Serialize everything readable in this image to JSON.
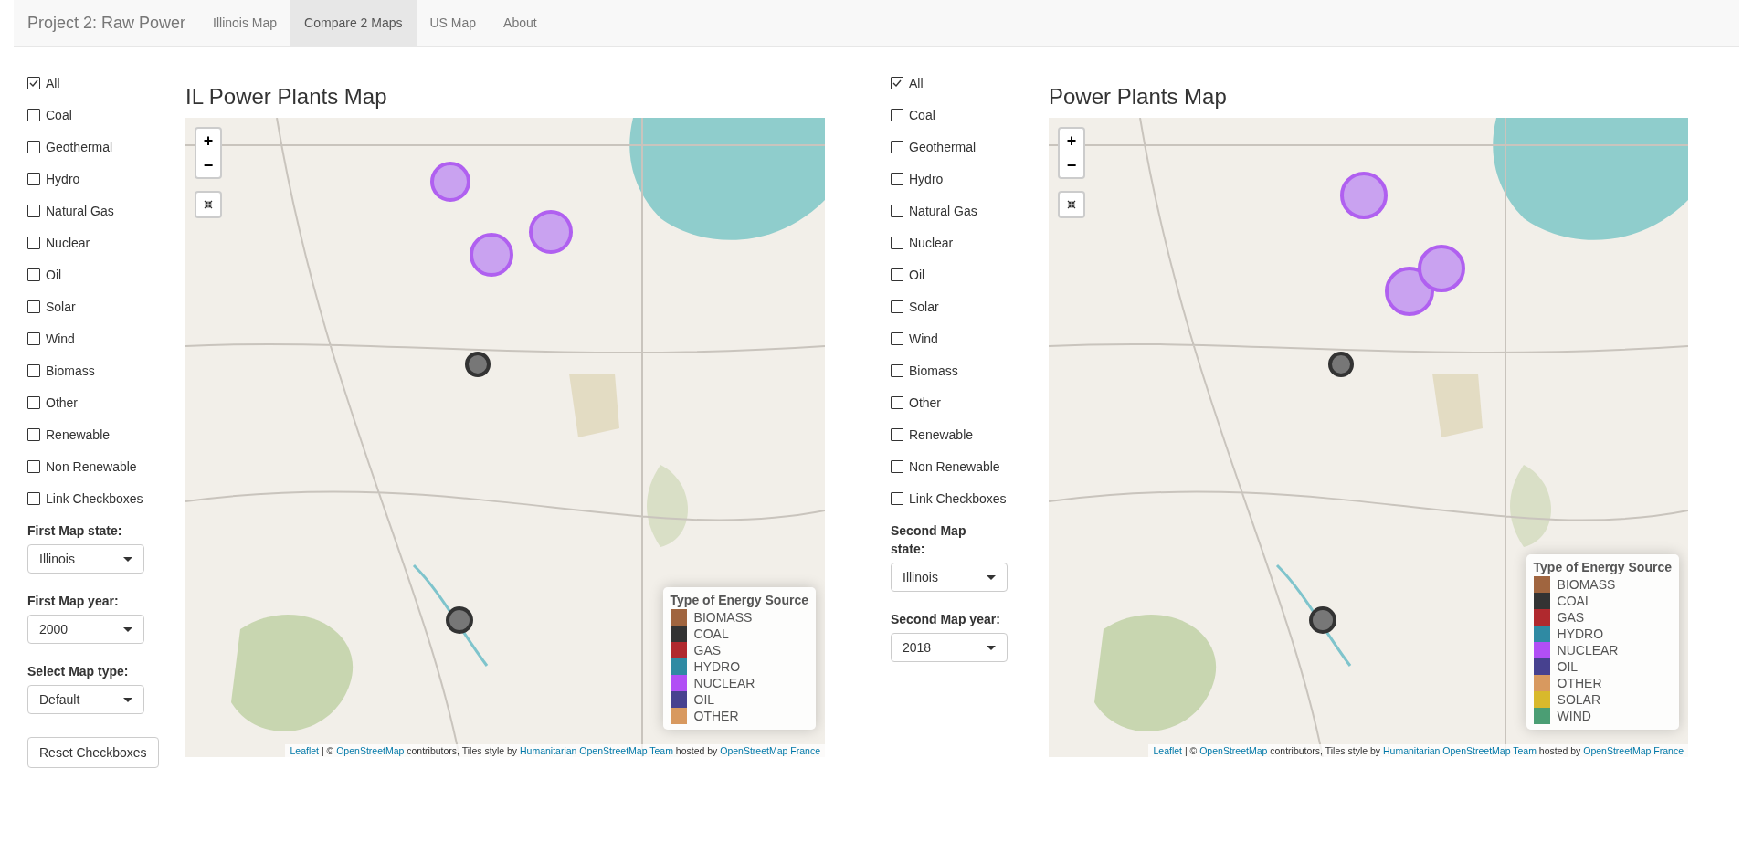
{
  "navbar": {
    "brand": "Project 2: Raw Power",
    "tabs": [
      {
        "label": "Illinois Map",
        "selected": false
      },
      {
        "label": "Compare 2 Maps",
        "selected": true
      },
      {
        "label": "US Map",
        "selected": false
      },
      {
        "label": "About",
        "selected": false
      }
    ]
  },
  "panels": [
    {
      "filters": [
        {
          "label": "All",
          "checked": true
        },
        {
          "label": "Coal",
          "checked": false
        },
        {
          "label": "Geothermal",
          "checked": false
        },
        {
          "label": "Hydro",
          "checked": false
        },
        {
          "label": "Natural Gas",
          "checked": false
        },
        {
          "label": "Nuclear",
          "checked": false
        },
        {
          "label": "Oil",
          "checked": false
        },
        {
          "label": "Solar",
          "checked": false
        },
        {
          "label": "Wind",
          "checked": false
        },
        {
          "label": "Biomass",
          "checked": false
        },
        {
          "label": "Other",
          "checked": false
        },
        {
          "label": "Renewable",
          "checked": false
        },
        {
          "label": "Non Renewable",
          "checked": false
        },
        {
          "label": "Link Checkboxes",
          "checked": false
        }
      ],
      "selects": [
        {
          "label": "First Map state:",
          "value": "Illinois"
        },
        {
          "label": "First Map year:",
          "value": "2000"
        },
        {
          "label": "Select Map type:",
          "value": "Default"
        }
      ],
      "button": "Reset Checkboxes",
      "map": {
        "title": "IL Power Plants Map",
        "zoom_in": "+",
        "zoom_out": "−",
        "legend": {
          "title": "Type of Energy Source",
          "items": [
            {
              "label": "BIOMASS",
              "color": "#a0653f"
            },
            {
              "label": "COAL",
              "color": "#333333"
            },
            {
              "label": "GAS",
              "color": "#b0292e"
            },
            {
              "label": "HYDRO",
              "color": "#2f8aa3"
            },
            {
              "label": "NUCLEAR",
              "color": "#b14ff5"
            },
            {
              "label": "OIL",
              "color": "#47418f"
            },
            {
              "label": "OTHER",
              "color": "#d8995f"
            }
          ]
        },
        "attribution": [
          {
            "text": "Leaflet",
            "link": true
          },
          {
            "text": " | © ",
            "link": false
          },
          {
            "text": "OpenStreetMap",
            "link": true
          },
          {
            "text": " contributors, Tiles style by ",
            "link": false
          },
          {
            "text": "Humanitarian OpenStreetMap Team",
            "link": true
          },
          {
            "text": " hosted by ",
            "link": false
          },
          {
            "text": "OpenStreetMap France",
            "link": true
          }
        ]
      }
    },
    {
      "filters": [
        {
          "label": "All",
          "checked": true
        },
        {
          "label": "Coal",
          "checked": false
        },
        {
          "label": "Geothermal",
          "checked": false
        },
        {
          "label": "Hydro",
          "checked": false
        },
        {
          "label": "Natural Gas",
          "checked": false
        },
        {
          "label": "Nuclear",
          "checked": false
        },
        {
          "label": "Oil",
          "checked": false
        },
        {
          "label": "Solar",
          "checked": false
        },
        {
          "label": "Wind",
          "checked": false
        },
        {
          "label": "Biomass",
          "checked": false
        },
        {
          "label": "Other",
          "checked": false
        },
        {
          "label": "Renewable",
          "checked": false
        },
        {
          "label": "Non Renewable",
          "checked": false
        },
        {
          "label": "Link Checkboxes",
          "checked": false
        }
      ],
      "selects": [
        {
          "label": "Second Map state:",
          "value": "Illinois"
        },
        {
          "label": "Second Map year:",
          "value": "2018"
        }
      ],
      "map": {
        "title": "Power Plants Map",
        "zoom_in": "+",
        "zoom_out": "−",
        "legend": {
          "title": "Type of Energy Source",
          "items": [
            {
              "label": "BIOMASS",
              "color": "#a0653f"
            },
            {
              "label": "COAL",
              "color": "#333333"
            },
            {
              "label": "GAS",
              "color": "#b0292e"
            },
            {
              "label": "HYDRO",
              "color": "#2f8aa3"
            },
            {
              "label": "NUCLEAR",
              "color": "#b14ff5"
            },
            {
              "label": "OIL",
              "color": "#47418f"
            },
            {
              "label": "OTHER",
              "color": "#d8995f"
            },
            {
              "label": "SOLAR",
              "color": "#d8b92c"
            },
            {
              "label": "WIND",
              "color": "#4b9e74"
            }
          ]
        },
        "attribution": [
          {
            "text": "Leaflet",
            "link": true
          },
          {
            "text": " | © ",
            "link": false
          },
          {
            "text": "OpenStreetMap",
            "link": true
          },
          {
            "text": " contributors, Tiles style by ",
            "link": false
          },
          {
            "text": "Humanitarian OpenStreetMap Team",
            "link": true
          },
          {
            "text": " hosted by ",
            "link": false
          },
          {
            "text": "OpenStreetMap France",
            "link": true
          }
        ]
      }
    }
  ]
}
